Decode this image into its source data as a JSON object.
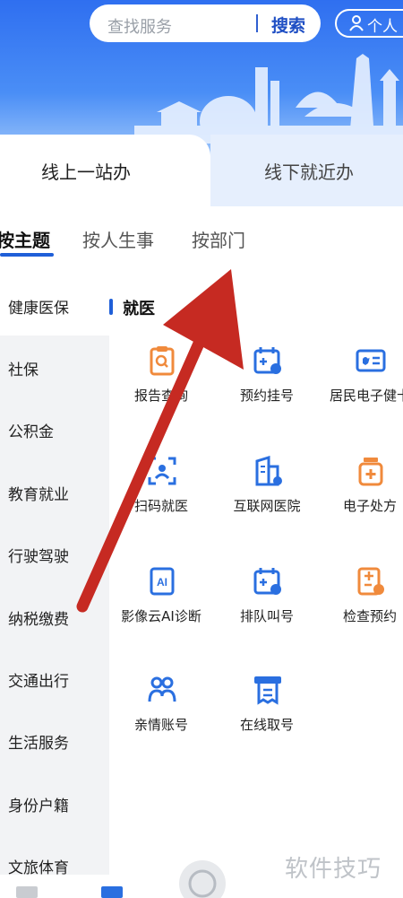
{
  "search": {
    "placeholder": "查找服务",
    "button": "搜索"
  },
  "personal": {
    "label": "个人"
  },
  "tabs": [
    {
      "label": "线上一站办"
    },
    {
      "label": "线下就近办"
    }
  ],
  "subtabs": [
    {
      "label": "按主题"
    },
    {
      "label": "按人生事"
    },
    {
      "label": "按部门"
    }
  ],
  "sidebar": {
    "items": [
      {
        "label": "健康医保"
      },
      {
        "label": "社保"
      },
      {
        "label": "公积金"
      },
      {
        "label": "教育就业"
      },
      {
        "label": "行驶驾驶"
      },
      {
        "label": "纳税缴费"
      },
      {
        "label": "交通出行"
      },
      {
        "label": "生活服务"
      },
      {
        "label": "身份户籍"
      },
      {
        "label": "文旅体育"
      }
    ]
  },
  "section": {
    "title": "就医"
  },
  "services": [
    {
      "label": "报告查询",
      "icon": "report-search-icon",
      "color": "#f08a3c"
    },
    {
      "label": "预约挂号",
      "icon": "calendar-register-icon",
      "color": "#2a6fe0"
    },
    {
      "label": "居民电子健卡",
      "icon": "health-card-icon",
      "color": "#2a6fe0"
    },
    {
      "label": "扫码就医",
      "icon": "scan-face-icon",
      "color": "#2a6fe0"
    },
    {
      "label": "互联网医院",
      "icon": "hospital-building-icon",
      "color": "#2a6fe0"
    },
    {
      "label": "电子处方",
      "icon": "prescription-bottle-icon",
      "color": "#f08a3c"
    },
    {
      "label": "影像云AI诊断",
      "icon": "ai-imaging-icon",
      "color": "#2a6fe0"
    },
    {
      "label": "排队叫号",
      "icon": "queue-calendar-icon",
      "color": "#2a6fe0"
    },
    {
      "label": "检查预约",
      "icon": "exam-booking-icon",
      "color": "#f08a3c"
    },
    {
      "label": "亲情账号",
      "icon": "family-account-icon",
      "color": "#2a6fe0"
    },
    {
      "label": "在线取号",
      "icon": "ticket-icon",
      "color": "#2a6fe0"
    }
  ],
  "watermark": "软件技巧",
  "colors": {
    "accent": "#1f5fd8",
    "orange": "#f08a3c",
    "arrow": "#c62a22"
  }
}
